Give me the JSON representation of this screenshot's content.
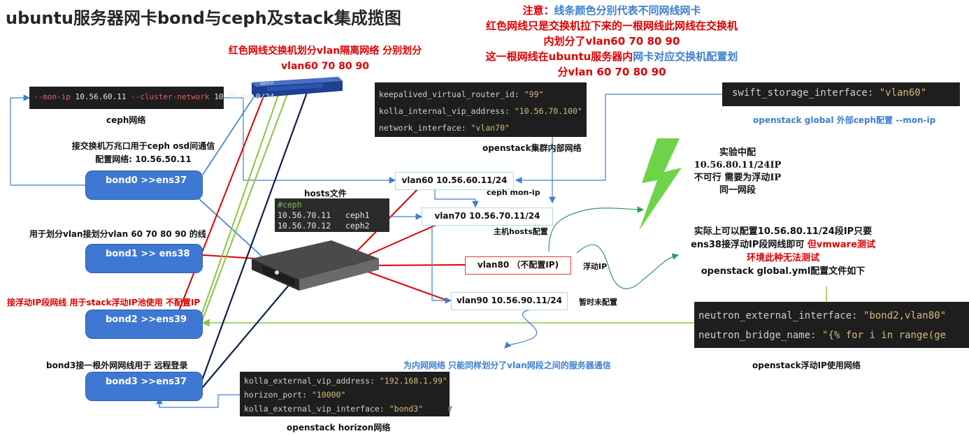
{
  "title": "ubuntu服务器网卡bond与ceph及stack集成揽图",
  "notice": {
    "line1_prefix": "注意：",
    "line1_main": "线条颜色分别代表不同网线网卡",
    "line2": "红色网线只是交换机拉下来的一根网线此网线在交换机",
    "line3": "内划分了vlan60 70 80 90",
    "line4_red": "这一根网线在ubuntu服务器内",
    "line4_blue": "网卡对应交换机配置划",
    "line5": "分vlan 60 70 80 90"
  },
  "switch_note": {
    "line1": "红色网线交换机划分vlan隔离网络 分别划分",
    "line2": "vlan60 70 80 90"
  },
  "code_ceph": {
    "flag1": "--mon-ip",
    "ip1": "10.56.60.11",
    "flag2": "--cluster-network",
    "ip2": "10.56.50.0/24",
    "caption": "ceph网络"
  },
  "bond0_note": {
    "line1": "接交换机万兆口用于ceph osd间通信",
    "line2": "配置网络:   10.56.50.11"
  },
  "bond1_note": "用于划分vlan接划分vlan 60 70 80 90 的线",
  "bond2_note": "接浮动IP段网线 用于stack浮动IP池使用 不配置IP",
  "bond3_note": "bond3接一根外网网线用于 远程登录",
  "bonds": {
    "bond0": "bond0 >>ens37",
    "bond1": "bond1 >> ens38",
    "bond2": "bond2 >>ens39",
    "bond3": "bond3 >>ens37"
  },
  "keepalived_code": {
    "l1k": "keepalived_virtual_router_id: ",
    "l1v": "\"99\"",
    "l2k": "kolla_internal_vip_address: ",
    "l2v": "\"10.56.70.100\"",
    "l3k": "network_interface: ",
    "l3v": "\"vlan70\"",
    "caption": "openstack集群内部网络"
  },
  "swift_code": {
    "key": "swift_storage_interface: ",
    "val": "\"vlan60\"",
    "caption": "openstack global 外部ceph配置 --mon-ip"
  },
  "hosts": {
    "label": "hosts文件",
    "comment": "#ceph",
    "r1ip": "10.56.70.11",
    "r1name": "ceph1",
    "r2ip": "10.56.70.12",
    "r2name": "ceph2"
  },
  "vlans": {
    "vlan60": "vlan60 10.56.60.11/24",
    "vlan60_note": "ceph mon-ip",
    "vlan70": "vlan70 10.56.70.11/24",
    "vlan70_note": "主机hosts配置",
    "vlan80": "vlan80  （不配置IP)",
    "vlan80_note": "浮动IP",
    "vlan90": "vlan90 10.56.90.11/24",
    "vlan90_note": "暂时未配置"
  },
  "experiment_note": {
    "l1": "实验中配",
    "l2": "10.56.80.11/24IP",
    "l3": "不可行 需要为浮动IP",
    "l4": "同一网段"
  },
  "actual_note": {
    "l1": "实际上可以配置10.56.80.11/24段IP只要",
    "l2a": "ens38接浮动IP段网线即可",
    "l2b": " 但vmware测试",
    "l3": "环境此种无法测试",
    "l4": "openstack global.yml配置文件如下"
  },
  "neutron_code": {
    "l1k": "neutron_external_interface: ",
    "l1v": "\"bond2,vlan80\"",
    "l2k": "neutron_bridge_name: ",
    "l2v": "\"{% for i in range(ge",
    "caption": "openstack浮动IP使用网络"
  },
  "vlan90_caption": "为内网网络 只能同样划分了vlan网段之间的服务器通信",
  "horizon_code": {
    "l1k": "kolla_external_vip_address: ",
    "l1v": "\"192.168.1.99\"",
    "l2k": "horizon_port: ",
    "l2v": "\"10000\"",
    "l3k": "kolla_external_vip_interface: ",
    "l3v": "\"bond3\"",
    "hash": "#",
    "caption": "openstack horizon网络"
  },
  "colors": {
    "red_wire": "#e00000",
    "blue_wire": "#3d7fd1",
    "green_wire": "#8cc63f",
    "navy_wire": "#0d1f4a",
    "bond_fill": "#3f78d3"
  }
}
